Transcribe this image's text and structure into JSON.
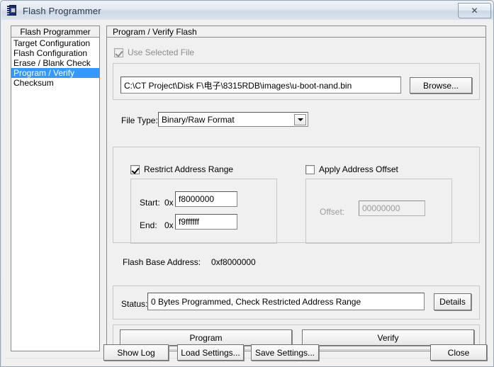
{
  "window": {
    "title": "Flash Programmer",
    "icon": "flash-document-icon",
    "close_label": "✕"
  },
  "sidebar": {
    "header": "Flash Programmer",
    "items": [
      {
        "label": "Target Configuration",
        "selected": false
      },
      {
        "label": "Flash Configuration",
        "selected": false
      },
      {
        "label": "Erase / Blank Check",
        "selected": false
      },
      {
        "label": "Program / Verify",
        "selected": true
      },
      {
        "label": "Checksum",
        "selected": false
      }
    ]
  },
  "main": {
    "header": "Program / Verify Flash",
    "use_selected_file": {
      "label": "Use Selected File",
      "checked": true,
      "enabled": false
    },
    "file_path": "C:\\CT Project\\Disk F\\电子\\8315RDB\\images\\u-boot-nand.bin",
    "browse_label": "Browse...",
    "file_type": {
      "label": "File Type:",
      "value": "Binary/Raw Format"
    },
    "restrict": {
      "label": "Restrict Address Range",
      "checked": true,
      "start_label": "Start:",
      "start_prefix": "0x",
      "start_value": "f8000000",
      "end_label": "End:",
      "end_prefix": "0x",
      "end_value": "f9ffffff"
    },
    "offset": {
      "label": "Apply Address Offset",
      "checked": false,
      "field_label": "Offset:",
      "value": "00000000",
      "enabled": false
    },
    "flash_base": {
      "label": "Flash Base Address:",
      "value": "0xf8000000"
    },
    "status": {
      "label": "Status:",
      "value": "0 Bytes Programmed, Check Restricted Address Range",
      "details_label": "Details"
    },
    "program_label": "Program",
    "verify_label": "Verify"
  },
  "footer": {
    "show_log": "Show Log",
    "load_settings": "Load Settings...",
    "save_settings": "Save Settings...",
    "close": "Close"
  },
  "colors": {
    "selection": "#3399ff",
    "window_bg": "#f0f0f0",
    "title_text": "#2b3a4a"
  }
}
